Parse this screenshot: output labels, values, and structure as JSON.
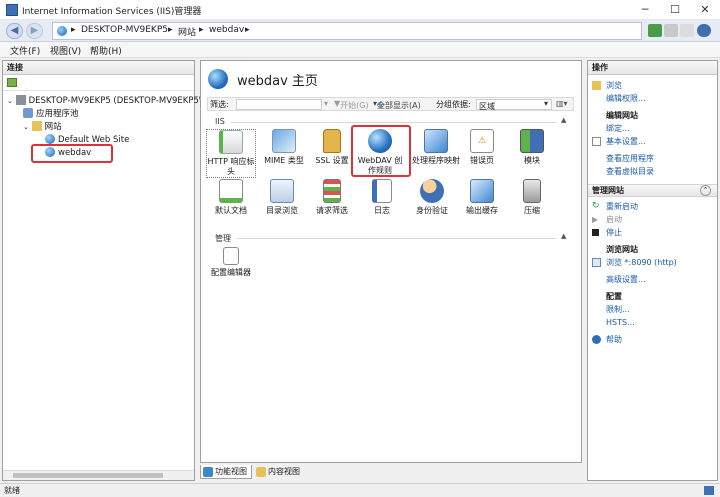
{
  "window": {
    "title": "Internet Information Services (IIS)管理器",
    "minimize": "─",
    "maximize": "☐",
    "close": "✕"
  },
  "address": {
    "crumbs": [
      "DESKTOP-MV9EKP5",
      "网站",
      "webdav"
    ],
    "sep": "▸"
  },
  "menu": [
    "文件(F)",
    "视图(V)",
    "帮助(H)"
  ],
  "connections": {
    "header": "连接",
    "tree": [
      {
        "label": "DESKTOP-MV9EKP5 (DESKTOP-MV9EKP5\\",
        "icon": "server-icon"
      },
      {
        "label": "应用程序池",
        "icon": "app-pool-icon"
      },
      {
        "label": "网站",
        "icon": "sites-folder-icon"
      },
      {
        "label": "Default Web Site",
        "icon": "globe-icon"
      },
      {
        "label": "webdav",
        "icon": "globe-icon"
      }
    ]
  },
  "center": {
    "title": "webdav 主页",
    "filter": {
      "label": "筛选:",
      "start": "开始(G)",
      "show_all": "全部显示(A)",
      "group_by_label": "分组依据:",
      "group_by_value": "区域"
    },
    "groups": [
      {
        "name": "IIS",
        "features": [
          {
            "label": "HTTP 响应标头",
            "icon": "http-response-headers-icon"
          },
          {
            "label": "MIME 类型",
            "icon": "mime-types-icon"
          },
          {
            "label": "SSL 设置",
            "icon": "ssl-lock-icon"
          },
          {
            "label": "WebDAV 创作规则",
            "icon": "webdav-icon"
          },
          {
            "label": "处理程序映射",
            "icon": "handler-mappings-icon"
          },
          {
            "label": "错误页",
            "icon": "error-pages-icon"
          },
          {
            "label": "模块",
            "icon": "modules-icon"
          },
          {
            "label": "默认文档",
            "icon": "default-document-icon"
          },
          {
            "label": "目录浏览",
            "icon": "directory-browsing-icon"
          },
          {
            "label": "请求筛选",
            "icon": "request-filtering-icon"
          },
          {
            "label": "日志",
            "icon": "logging-icon"
          },
          {
            "label": "身份验证",
            "icon": "authentication-icon"
          },
          {
            "label": "输出缓存",
            "icon": "output-caching-icon"
          },
          {
            "label": "压缩",
            "icon": "compression-icon"
          }
        ]
      },
      {
        "name": "管理",
        "features": [
          {
            "label": "配置编辑器",
            "icon": "configuration-editor-icon"
          }
        ]
      }
    ],
    "tabs": [
      "功能视图",
      "内容视图"
    ]
  },
  "actions": {
    "header": "操作",
    "browse": "浏览",
    "edit_permissions": "编辑权限...",
    "edit_site_head": "编辑网站",
    "bindings": "绑定...",
    "basic_settings": "基本设置...",
    "view_apps": "查看应用程序",
    "view_vdirs": "查看虚拟目录",
    "manage_site": "管理网站",
    "restart": "重新启动",
    "start": "启动",
    "stop": "停止",
    "browse_site_head": "浏览网站",
    "browse_port": "浏览 *:8090 (http)",
    "advanced": "高级设置...",
    "config_head": "配置",
    "limits": "限制...",
    "hsts": "HSTS...",
    "help": "帮助"
  },
  "status": "就绪",
  "colors": {
    "highlight_box": "#d9323a",
    "link": "#1a5aa6"
  }
}
